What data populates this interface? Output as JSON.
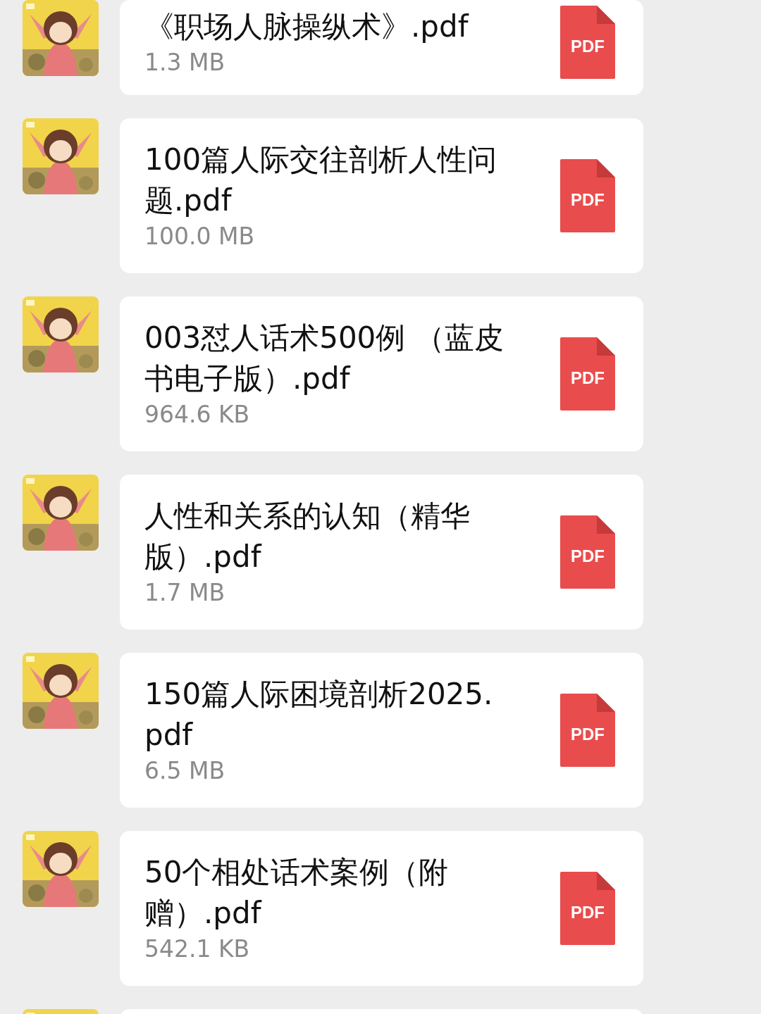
{
  "messages": [
    {
      "kind": "file",
      "title": "《职场人脉操纵术》.pdf",
      "size": "1.3 MB",
      "file_type": "PDF"
    },
    {
      "kind": "file",
      "title": "100篇人际交往剖析人性问题.pdf",
      "size": "100.0 MB",
      "file_type": "PDF"
    },
    {
      "kind": "file",
      "title": "003怼人话术500例 （蓝皮书电子版）.pdf",
      "size": "964.6 KB",
      "file_type": "PDF"
    },
    {
      "kind": "file",
      "title": "人性和关系的认知（精华版）.pdf",
      "size": "1.7 MB",
      "file_type": "PDF"
    },
    {
      "kind": "file",
      "title": "150篇人际困境剖析2025.pdf",
      "size": "6.5 MB",
      "file_type": "PDF"
    },
    {
      "kind": "file",
      "title": "50个相处话术案例（附赠）.pdf",
      "size": "542.1 KB",
      "file_type": "PDF"
    },
    {
      "kind": "partial"
    }
  ]
}
